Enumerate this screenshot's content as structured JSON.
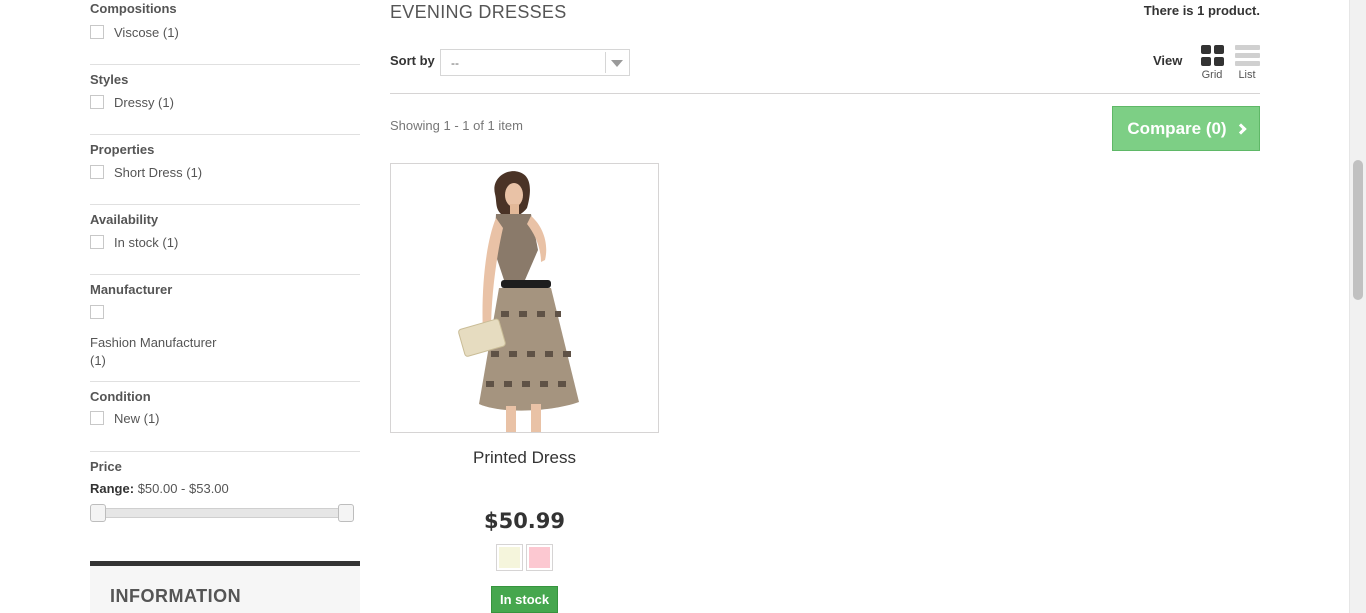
{
  "filters": {
    "compositions": {
      "title": "Compositions",
      "items": [
        {
          "label": "Viscose (1)"
        }
      ]
    },
    "styles": {
      "title": "Styles",
      "items": [
        {
          "label": "Dressy (1)"
        }
      ]
    },
    "properties": {
      "title": "Properties",
      "items": [
        {
          "label": "Short Dress (1)"
        }
      ]
    },
    "availability": {
      "title": "Availability",
      "items": [
        {
          "label": "In stock (1)"
        }
      ]
    },
    "manufacturer": {
      "title": "Manufacturer",
      "items": [
        {
          "label": "Fashion Manufacturer",
          "count": "(1)"
        }
      ]
    },
    "condition": {
      "title": "Condition",
      "items": [
        {
          "label": "New (1)"
        }
      ]
    },
    "price": {
      "title": "Price",
      "range_label": "Range:",
      "range_value": "$50.00 - $53.00",
      "min": 50.0,
      "max": 53.0
    }
  },
  "info_block": {
    "title": "INFORMATION"
  },
  "category": {
    "title": "EVENING DRESSES",
    "count_text": "There is 1 product."
  },
  "sort": {
    "label": "Sort by",
    "selected": "--"
  },
  "view": {
    "label": "View",
    "grid_label": "Grid",
    "list_label": "List",
    "active": "grid"
  },
  "listing": {
    "showing": "Showing 1 - 1 of 1 item",
    "compare_label": "Compare (0)"
  },
  "product": {
    "name": "Printed Dress",
    "price": "$50.99",
    "stock": "In stock",
    "colors": [
      "#f5f5dc",
      "#fcc8d1"
    ]
  },
  "colors": {
    "compare": "#7dcf85",
    "stock": "#46a74e"
  }
}
